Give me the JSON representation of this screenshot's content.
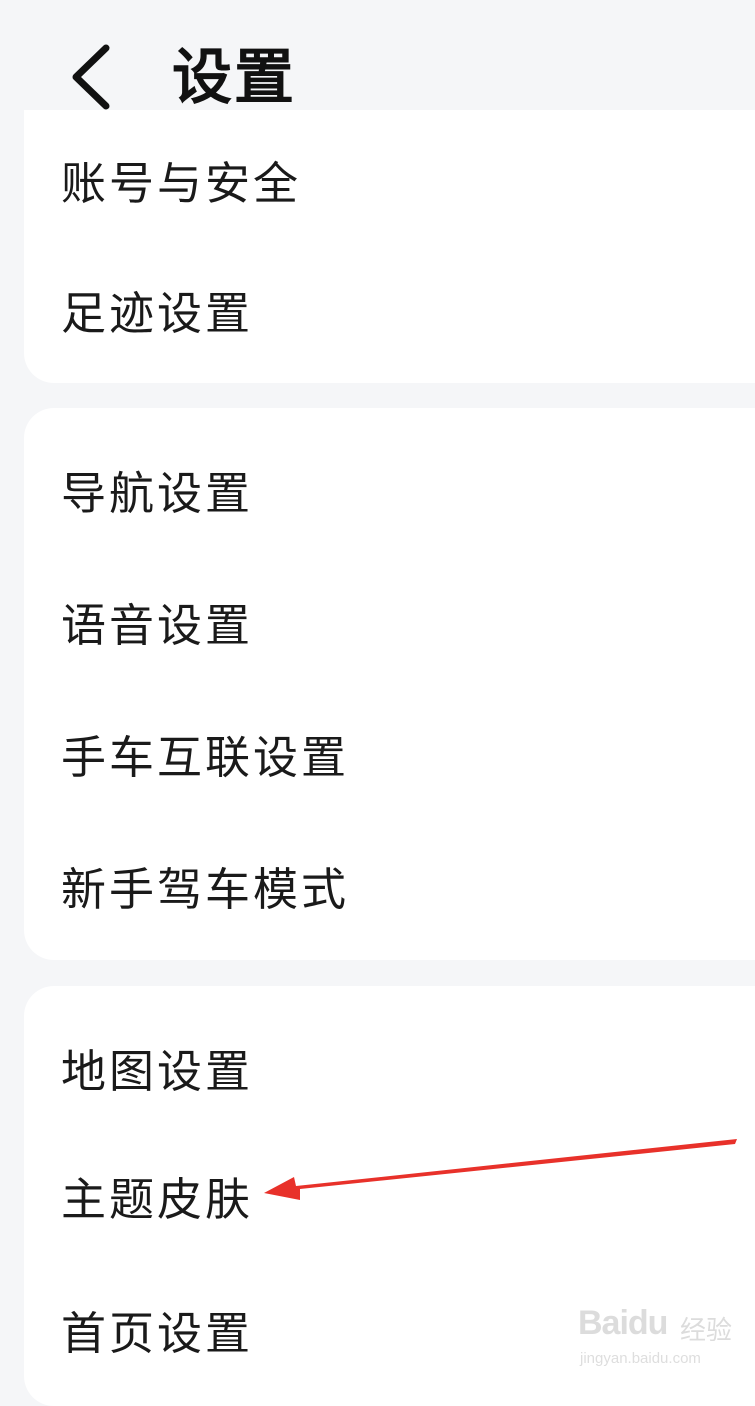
{
  "header": {
    "title": "设置",
    "back_icon": "chevron-left-icon"
  },
  "groups": [
    {
      "items": [
        {
          "label": "账号与安全"
        },
        {
          "label": "足迹设置"
        }
      ]
    },
    {
      "items": [
        {
          "label": "导航设置"
        },
        {
          "label": "语音设置"
        },
        {
          "label": "手车互联设置"
        },
        {
          "label": "新手驾车模式"
        }
      ]
    },
    {
      "items": [
        {
          "label": "地图设置"
        },
        {
          "label": "主题皮肤"
        },
        {
          "label": "首页设置"
        }
      ]
    }
  ],
  "colors": {
    "background": "#f5f6f8",
    "card": "#ffffff",
    "text": "#1a1a1a",
    "annotation_arrow": "#e8312a"
  },
  "watermark": {
    "logo": "Baidu",
    "label": "经验",
    "url": "jingyan.baidu.com"
  }
}
